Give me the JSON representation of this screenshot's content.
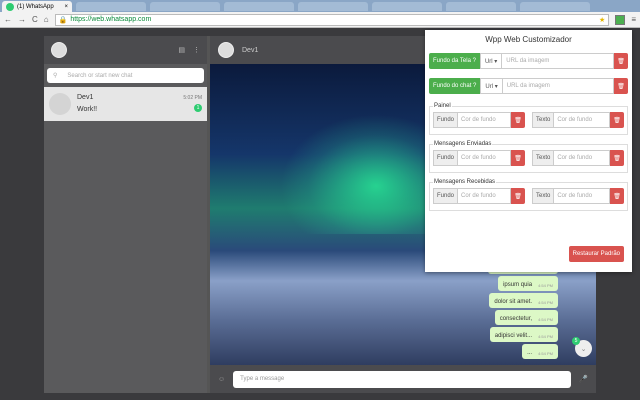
{
  "browser": {
    "tab_title": "(1) WhatsApp",
    "tab_close": "×",
    "url": "https://web.whatsapp.com",
    "back": "←",
    "forward": "→",
    "reload": "C",
    "home": "⌂",
    "star": "★",
    "menu": "≡"
  },
  "sidebar": {
    "search_placeholder": "Search or start new chat",
    "chats": [
      {
        "name": "Dev1",
        "last": "Work!!",
        "time": "5:02 PM",
        "unread": "1"
      }
    ]
  },
  "chat": {
    "contact": "Dev1",
    "input_placeholder": "Type a message",
    "messages": [
      {
        "text": "ipsum quia",
        "time": "4:54 PM"
      },
      {
        "text": "dolor sit amet.",
        "time": "4:54 PM"
      },
      {
        "text": "consectetur,",
        "time": "4:54 PM"
      },
      {
        "text": "adipisci velit...",
        "time": "4:54 PM"
      },
      {
        "text": "...",
        "time": "4:54 PM"
      }
    ],
    "scroll_badge": "5"
  },
  "popup": {
    "title": "Wpp Web Customizador",
    "screen_bg": "Fundo da Tela",
    "chat_bg": "Fundo do chat",
    "help": "?",
    "url_dropdown": "Url ▾",
    "url_placeholder": "URL da imagem",
    "sections": [
      {
        "title": "Painel"
      },
      {
        "title": "Mensagens Enviadas"
      },
      {
        "title": "Mensagens Recebidas"
      }
    ],
    "bg_label": "Fundo",
    "text_label": "Texto",
    "color_placeholder": "Cor de fundo",
    "reset": "Restaurar Padrão"
  },
  "colors": {
    "green": "#4cae4c",
    "red": "#d9534f",
    "bubble": "#dcf8c6"
  }
}
